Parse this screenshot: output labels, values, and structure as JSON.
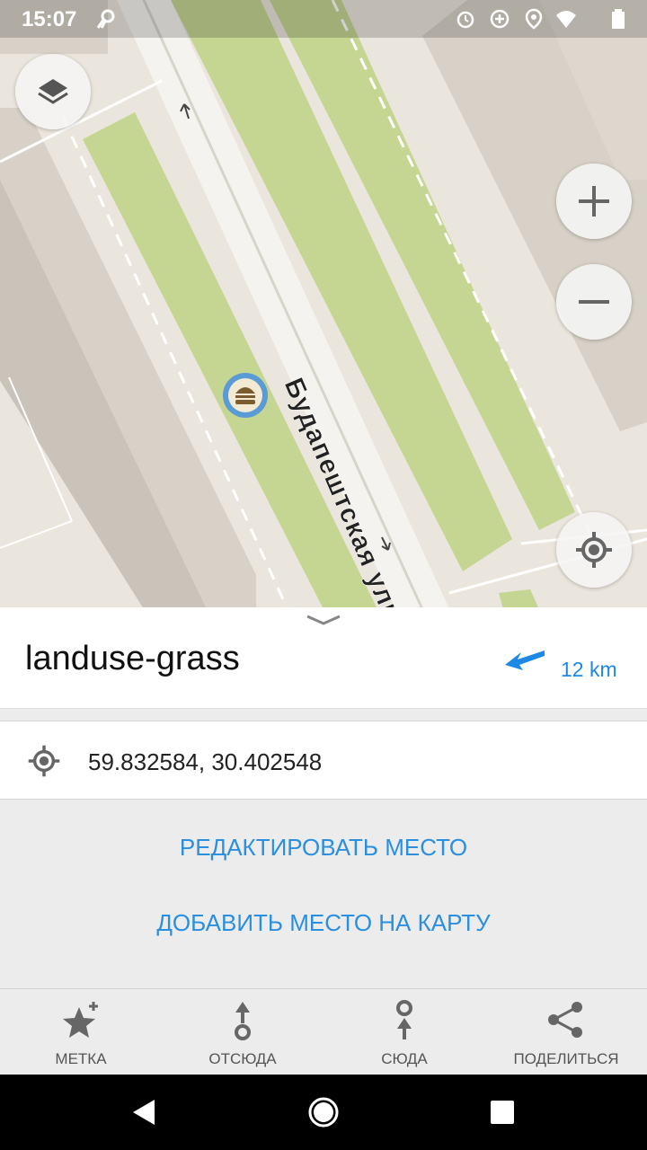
{
  "status_bar": {
    "time": "15:07",
    "icons": [
      "navigation-app-icon",
      "alarm-icon",
      "data-saver-icon",
      "location-icon",
      "wifi-icon",
      "battery-icon"
    ]
  },
  "map": {
    "street_label": "Будапештская улица",
    "poi_icon": "burger-icon",
    "controls": [
      "layers-icon",
      "zoom-in-icon",
      "zoom-out-icon",
      "my-location-icon"
    ]
  },
  "place": {
    "title": "landuse-grass",
    "distance": "12 km",
    "distance_icon": "direction-arrow-icon",
    "accent_color": "#1e88e5"
  },
  "coordinates": {
    "value": "59.832584, 30.402548",
    "icon": "location-target-icon"
  },
  "actions": {
    "edit_place": "РЕДАКТИРОВАТЬ МЕСТО",
    "add_place": "ДОБАВИТЬ МЕСТО НА КАРТУ"
  },
  "bottom_bar": {
    "items": [
      {
        "label": "МЕТКА",
        "icon": "star-add-icon"
      },
      {
        "label": "ОТСЮДА",
        "icon": "route-from-icon"
      },
      {
        "label": "СЮДА",
        "icon": "route-to-icon"
      },
      {
        "label": "ПОДЕЛИТЬСЯ",
        "icon": "share-icon"
      }
    ]
  },
  "nav_bar": [
    "back-icon",
    "home-icon",
    "recents-icon"
  ]
}
